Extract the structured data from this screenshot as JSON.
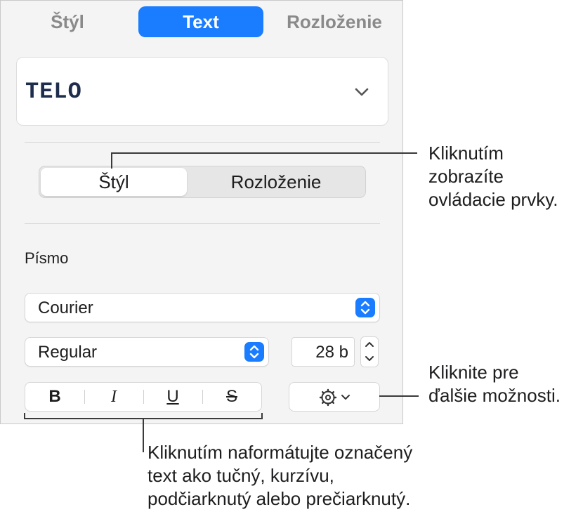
{
  "tabs": [
    {
      "label": "Štýl",
      "active": false
    },
    {
      "label": "Text",
      "active": true
    },
    {
      "label": "Rozloženie",
      "active": false
    }
  ],
  "paragraph_style": {
    "name": "TELO"
  },
  "sub_tabs": [
    {
      "label": "Štýl",
      "active": true
    },
    {
      "label": "Rozloženie",
      "active": false
    }
  ],
  "font_section": {
    "label": "Písmo",
    "family": "Courier",
    "typeface": "Regular",
    "size": "28 b"
  },
  "format_buttons": [
    {
      "label": "B",
      "name": "bold-button"
    },
    {
      "label": "I",
      "name": "italic-button"
    },
    {
      "label": "U",
      "name": "underline-button"
    },
    {
      "label": "S",
      "name": "strikethrough-button"
    }
  ],
  "callouts": {
    "controls_lines": [
      "Kliknutím",
      "zobrazíte",
      "ovládacie prvky."
    ],
    "more_lines": [
      "Kliknite pre",
      "ďalšie možnosti."
    ],
    "format_lines": [
      "Kliknutím naformátujte označený",
      "text ako tučný, kurzívu,",
      "podčiarknutý alebo prečiarknutý."
    ]
  },
  "colors": {
    "accent": "#1a7cff",
    "panel": "#f4f4f4",
    "style_text": "#1f2d4d"
  },
  "icons": [
    "chevron-down-icon",
    "up-down-arrows-icon",
    "stepper-icon",
    "gear-icon"
  ]
}
